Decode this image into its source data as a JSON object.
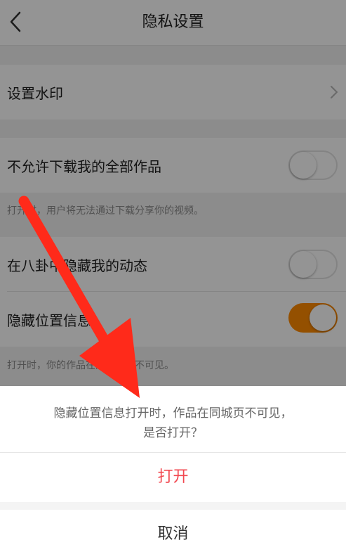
{
  "navbar": {
    "title": "隐私设置"
  },
  "settings": {
    "watermark_label": "设置水印",
    "no_download_label": "不允许下载我的全部作品",
    "no_download_hint": "打开时，用户将无法通过下载分享你的视频。",
    "no_download_state": "off",
    "hide_gossip_label": "在八卦中隐藏我的动态",
    "hide_gossip_state": "off",
    "hide_location_label": "隐藏位置信息",
    "hide_location_hint": "打开时，你的作品在同城页面不可见。",
    "hide_location_state": "on"
  },
  "sheet": {
    "message_line1": "隐藏位置信息打开时，作品在同城页不可见，",
    "message_line2": "是否打开？",
    "confirm_label": "打开",
    "cancel_label": "取消"
  },
  "colors": {
    "accent": "#ff8a00",
    "danger": "#f2474f",
    "annotation": "#ff2a1a"
  }
}
